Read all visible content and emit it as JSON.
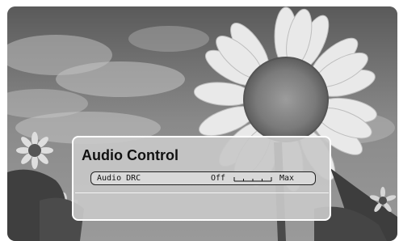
{
  "panel": {
    "title": "Audio Control",
    "setting": {
      "label": "Audio DRC",
      "min_label": "Off",
      "max_label": "Max",
      "level": 0.0
    }
  }
}
